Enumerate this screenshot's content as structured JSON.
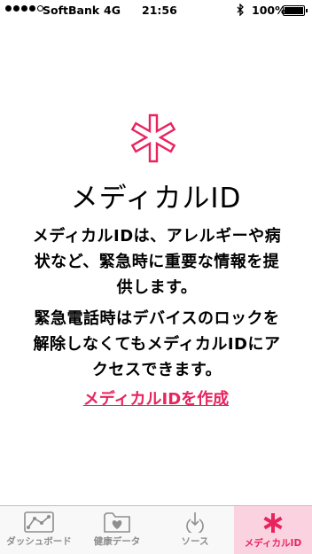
{
  "status": {
    "carrier": "SoftBank",
    "network": "4G",
    "time": "21:56",
    "battery": "100%"
  },
  "main": {
    "title": "メディカルID",
    "paragraph1_line1": "メディカルIDは、アレルギーや病",
    "paragraph1_line2": "状など、緊急時に重要な情報を提",
    "paragraph1_line3": "供します。",
    "paragraph2_line1": "緊急電話時はデバイスのロックを",
    "paragraph2_line2": "解除しなくてもメディカルIDにア",
    "paragraph2_line3": "クセスできます。",
    "create_link": "メディカルIDを作成"
  },
  "tabs": [
    {
      "label": "ダッシュボード",
      "icon": "dashboard-icon"
    },
    {
      "label": "健康データ",
      "icon": "health-data-icon"
    },
    {
      "label": "ソース",
      "icon": "sources-icon"
    },
    {
      "label": "メディカルID",
      "icon": "medical-id-icon"
    }
  ],
  "colors": {
    "accent": "#e8245f",
    "active_tab_bg": "#fbd2e0"
  }
}
